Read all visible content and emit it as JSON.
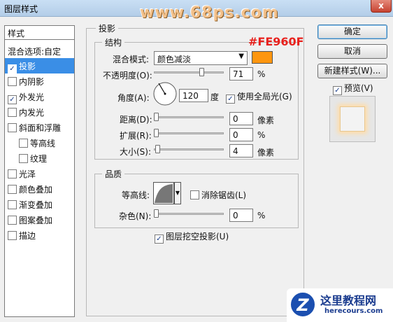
{
  "window": {
    "title": "图层样式",
    "close_label": "x"
  },
  "watermark": "www.68ps.com",
  "left_panel": {
    "header": "样式",
    "blend_options": "混合选项:自定",
    "items": [
      {
        "label": "投影",
        "checked": true,
        "selected": true,
        "indent": false
      },
      {
        "label": "内阴影",
        "checked": false,
        "selected": false,
        "indent": false
      },
      {
        "label": "外发光",
        "checked": true,
        "selected": false,
        "indent": false
      },
      {
        "label": "内发光",
        "checked": false,
        "selected": false,
        "indent": false
      },
      {
        "label": "斜面和浮雕",
        "checked": false,
        "selected": false,
        "indent": false
      },
      {
        "label": "等高线",
        "checked": false,
        "selected": false,
        "indent": true
      },
      {
        "label": "纹理",
        "checked": false,
        "selected": false,
        "indent": true
      },
      {
        "label": "光泽",
        "checked": false,
        "selected": false,
        "indent": false
      },
      {
        "label": "颜色叠加",
        "checked": false,
        "selected": false,
        "indent": false
      },
      {
        "label": "渐变叠加",
        "checked": false,
        "selected": false,
        "indent": false
      },
      {
        "label": "图案叠加",
        "checked": false,
        "selected": false,
        "indent": false
      },
      {
        "label": "描边",
        "checked": false,
        "selected": false,
        "indent": false
      }
    ]
  },
  "shadow": {
    "section_title": "投影",
    "structure_title": "结构",
    "color_annotation": "#FE960F",
    "swatch_color": "#fe960f",
    "blend_mode_label": "混合模式:",
    "blend_mode_value": "颜色减淡",
    "opacity_label": "不透明度(O):",
    "opacity_value": "71",
    "opacity_unit": "%",
    "opacity_level": 0.71,
    "angle_label": "角度(A):",
    "angle_value": "120",
    "angle_unit": "度",
    "global_light_label": "使用全局光(G)",
    "distance_label": "距离(D):",
    "distance_value": "0",
    "distance_unit": "像素",
    "distance_level": 0,
    "spread_label": "扩展(R):",
    "spread_value": "0",
    "spread_unit": "%",
    "spread_level": 0,
    "size_label": "大小(S):",
    "size_value": "4",
    "size_unit": "像素",
    "size_level": 0.02,
    "quality_title": "品质",
    "contour_label": "等高线:",
    "antialias_label": "消除锯齿(L)",
    "noise_label": "杂色(N):",
    "noise_value": "0",
    "noise_unit": "%",
    "noise_level": 0,
    "knockout_label": "图层挖空投影(U)"
  },
  "buttons": {
    "ok": "确定",
    "cancel": "取消",
    "new_style": "新建样式(W)...",
    "preview": "预览(V)"
  },
  "logo": {
    "letter": "Z",
    "title": "这里教程网",
    "url": "herecours.com"
  }
}
